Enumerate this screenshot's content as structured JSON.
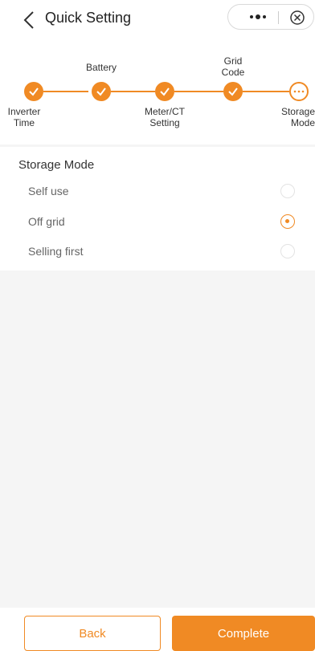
{
  "header": {
    "title": "Quick Setting"
  },
  "steps": [
    {
      "label_top": "",
      "label_bottom": "Inverter\nTime"
    },
    {
      "label_top": "Battery",
      "label_bottom": ""
    },
    {
      "label_top": "",
      "label_bottom": "Meter/CT\nSetting"
    },
    {
      "label_top": "Grid\nCode",
      "label_bottom": ""
    },
    {
      "label_top": "",
      "label_bottom": "Storage\nMode"
    }
  ],
  "storage": {
    "title": "Storage Mode",
    "options": [
      "Self use",
      "Off grid",
      "Selling first"
    ],
    "selected": "Off grid"
  },
  "footer": {
    "back_label": "Back",
    "complete_label": "Complete"
  },
  "colors": {
    "accent": "#f08a24"
  }
}
